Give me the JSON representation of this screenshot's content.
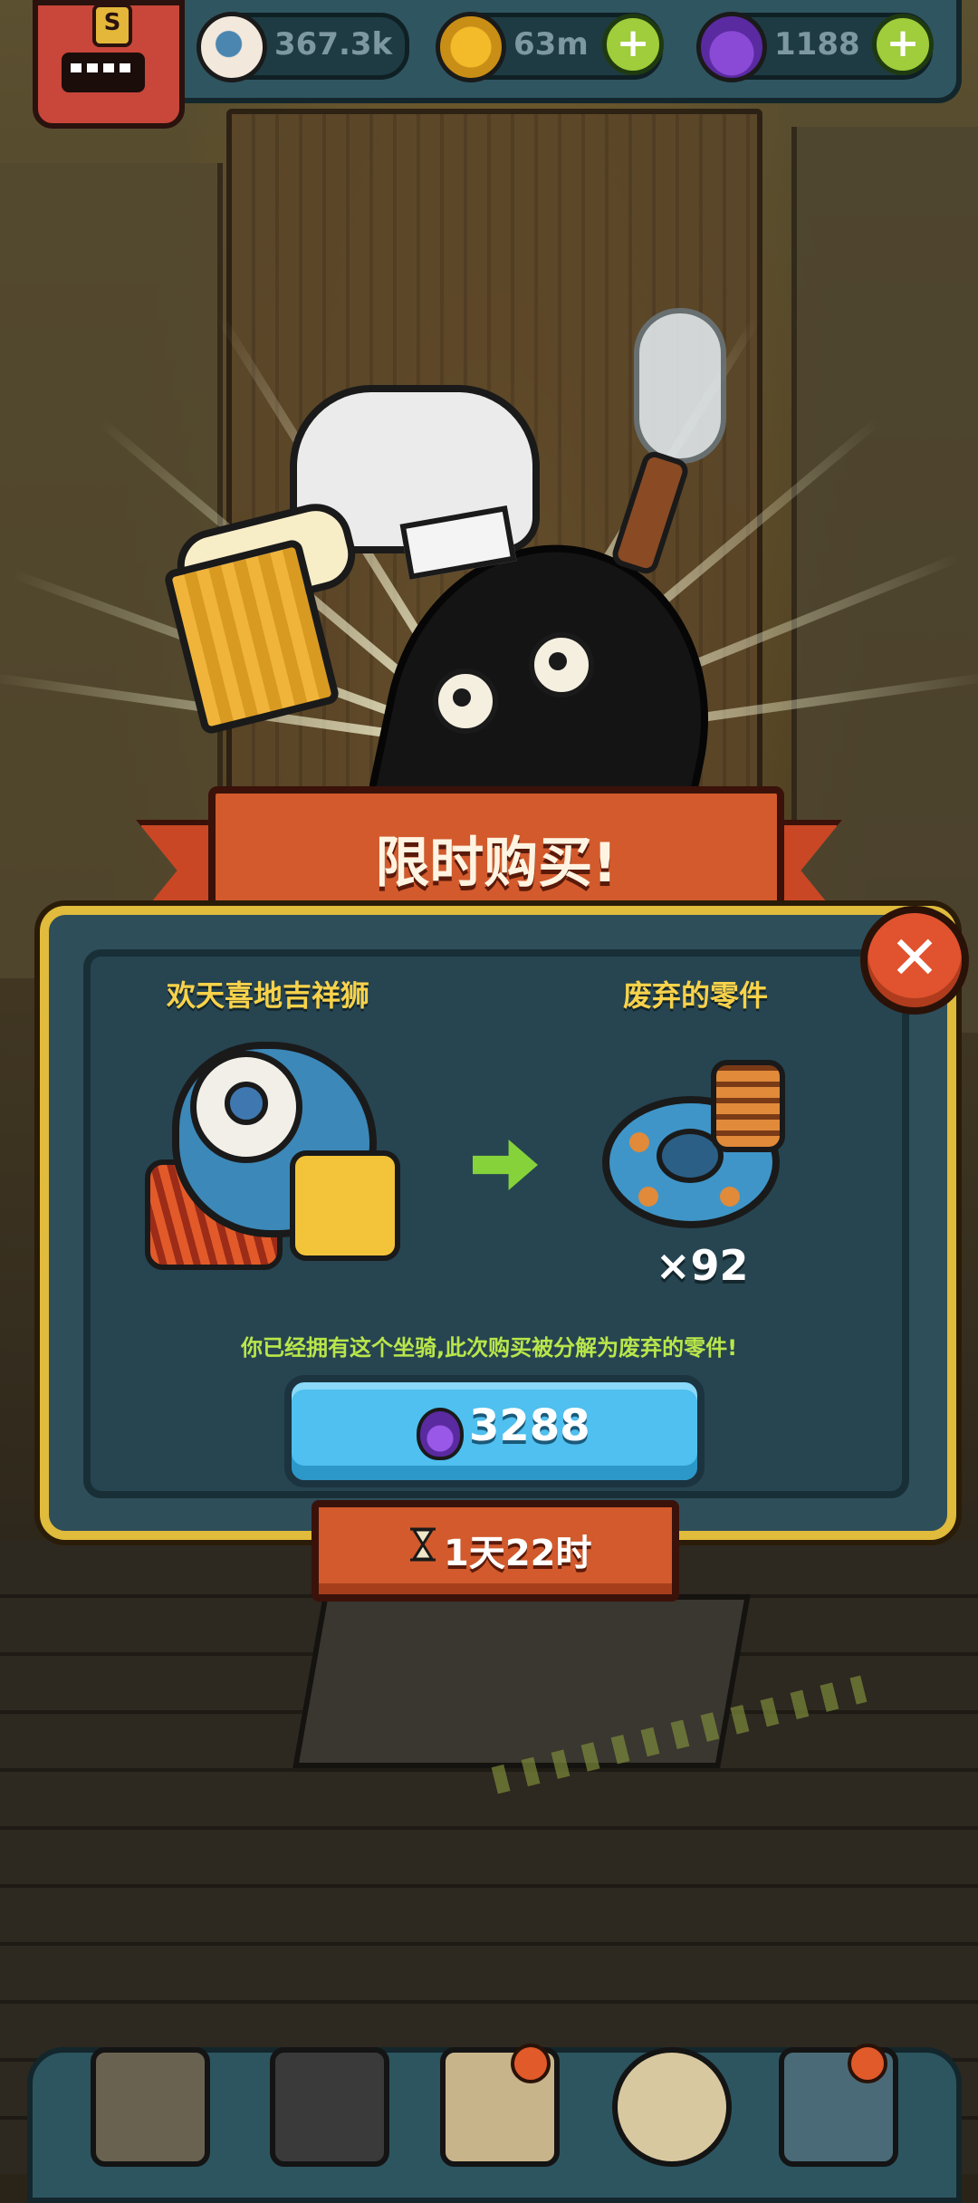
{
  "hud": {
    "eyes_value": "367.3k",
    "coins_value": "63m",
    "potions_value": "1188",
    "plus_label": "+"
  },
  "offer": {
    "title": "限时购买!",
    "item_from_name": "欢天喜地吉祥狮",
    "item_to_name": "废弃的零件",
    "quantity": "×92",
    "notice": "你已经拥有这个坐骑,此次购买被分解为废弃的零件!",
    "price": "3288",
    "timer": "1天22时",
    "close_label": "✕"
  },
  "colors": {
    "banner": "#d25a2c",
    "frame_gold": "#e0bb3c",
    "panel": "#264551",
    "buy_button": "#4fc0ef",
    "item_name": "#f8d24a",
    "notice": "#b9e64a",
    "plus_button": "#9fcd3b"
  },
  "icons": {
    "eye_currency": "eyeball-icon",
    "coin_currency": "coin-icon",
    "potion_currency": "potion-icon",
    "close": "close-icon",
    "arrow": "arrow-right-icon",
    "timer": "hourglass-icon"
  }
}
